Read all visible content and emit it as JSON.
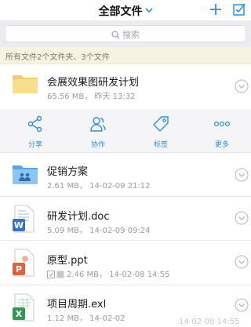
{
  "header": {
    "title": "全部文件"
  },
  "search": {
    "placeholder": "搜索"
  },
  "summary": "所有文件2个文件夹、3个文件",
  "files": [
    {
      "name": "会展效果图研发计划",
      "size": "65.56 MB",
      "date": "昨天 13:32",
      "icon": "folder-icon"
    },
    {
      "name": "促销方案",
      "size": "2.61 MB",
      "date": "14-02-09  21:12",
      "icon": "shared-folder-icon"
    },
    {
      "name": "研发计划.doc",
      "size": "5.09 MB",
      "date": "14-02-09  09:24",
      "icon": "word-doc-icon"
    },
    {
      "name": "原型.ppt",
      "size": "2.46 MB",
      "date": "14-02-08  14:55",
      "icon": "ppt-icon"
    },
    {
      "name": "项目周期.exl",
      "size": "1.12 MB",
      "date": "14-02-02",
      "icon": "excel-icon"
    }
  ],
  "actions": [
    {
      "label": "分享",
      "icon": "share-icon"
    },
    {
      "label": "协作",
      "icon": "collaborate-icon"
    },
    {
      "label": "标签",
      "icon": "tag-icon"
    },
    {
      "label": "更多",
      "icon": "more-icon"
    }
  ],
  "bottom_overlay_date": "14-02-08  14:55",
  "colors": {
    "accent": "#2f8fe0",
    "folder": "#f7d77e",
    "summary_bg": "#f6f3e2"
  }
}
